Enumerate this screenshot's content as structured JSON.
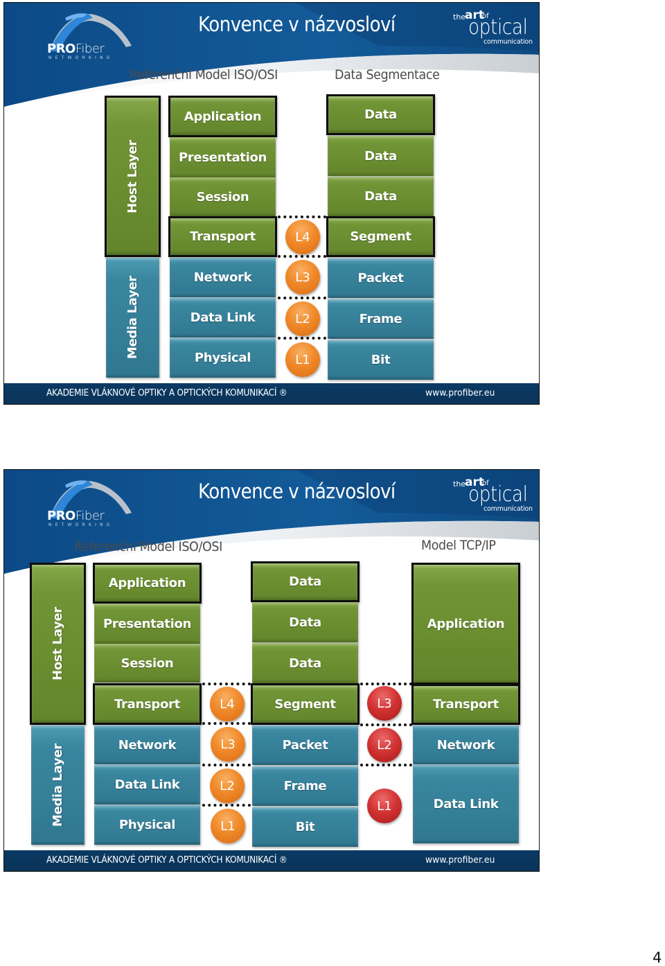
{
  "slides": [
    {
      "title": "Konvence v názvosloví",
      "logo": {
        "bold": "PRO",
        "thin": "Fiber",
        "sub": "NETWORKING"
      },
      "brand": {
        "the": "the",
        "art": "art",
        "of": "of",
        "optical": "optical",
        "communication": "communication"
      },
      "left_heading": "Referenční Model ISO/OSI",
      "right_heading": "Data Segmentace",
      "groups": {
        "host": "Host Layer",
        "media": "Media Layer"
      },
      "osi_layers": [
        "Application",
        "Presentation",
        "Session",
        "Transport",
        "Network",
        "Data Link",
        "Physical"
      ],
      "layer_badges": [
        "L4",
        "L3",
        "L2",
        "L1"
      ],
      "pdus": [
        "Data",
        "Data",
        "Data",
        "Segment",
        "Packet",
        "Frame",
        "Bit"
      ],
      "footer": {
        "left": "AKADEMIE VLÁKNOVÉ OPTIKY  A OPTICKÝCH KOMUNIKACÍ ®",
        "right": "www.profiber.eu"
      }
    },
    {
      "title": "Konvence v názvosloví",
      "logo": {
        "bold": "PRO",
        "thin": "Fiber",
        "sub": "NETWORKING"
      },
      "brand": {
        "the": "the",
        "art": "art",
        "of": "of",
        "optical": "optical",
        "communication": "communication"
      },
      "left_heading": "Referenční Model ISO/OSI",
      "right_heading": "Model TCP/IP",
      "groups": {
        "host": "Host Layer",
        "media": "Media Layer"
      },
      "osi_layers": [
        "Application",
        "Presentation",
        "Session",
        "Transport",
        "Network",
        "Data Link",
        "Physical"
      ],
      "layer_badges": [
        "L4",
        "L3",
        "L2",
        "L1"
      ],
      "pdus": [
        "Data",
        "Data",
        "Data",
        "Segment",
        "Packet",
        "Frame",
        "Bit"
      ],
      "tcpip_badges": [
        "L3",
        "L2",
        "L1"
      ],
      "tcpip_layers": [
        "Application",
        "Transport",
        "Network",
        "Data Link"
      ],
      "footer": {
        "left": "AKADEMIE VLÁKNOVÉ OPTIKY  A OPTICKÝCH KOMUNIKACÍ ®",
        "right": "www.profiber.eu"
      }
    }
  ],
  "colors": {
    "green": "#6a8d30",
    "blue": "#357f98",
    "orange": "#f0892a",
    "red": "#d23333",
    "navy": "#0b3a64"
  },
  "page_number": "4"
}
